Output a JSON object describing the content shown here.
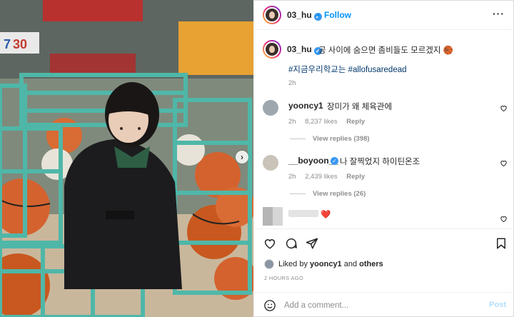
{
  "header": {
    "username": "03_hu",
    "verified_mark": "✓",
    "separator": "•",
    "follow_label": "Follow",
    "more_label": "···"
  },
  "caption": {
    "username": "03_hu",
    "text": "공 사이에 숨으면 좀비들도 모르겠지 🏀",
    "hashtags": [
      "#지금우리학교는",
      "#allofusaredead"
    ],
    "time": "2h"
  },
  "comments": [
    {
      "username": "yooncy1",
      "text": "장미가 왜 체육관에",
      "time": "2h",
      "likes": "8,237 likes",
      "reply_label": "Reply",
      "view_replies": "View replies (398)"
    },
    {
      "username": "__boyoon__",
      "text": "나 잘찍었지 하이틴온조",
      "time": "2h",
      "likes": "2,439 likes",
      "reply_label": "Reply",
      "view_replies": "View replies (26)"
    },
    {
      "username": "",
      "text": "❤️"
    }
  ],
  "actions": {
    "liked_by_prefix": "Liked by",
    "liked_by_user": "yooncy1",
    "liked_by_and": "and",
    "liked_by_others": "others",
    "post_time": "2 HOURS AGO"
  },
  "comment_box": {
    "placeholder": "Add a comment...",
    "post_label": "Post"
  },
  "photo": {
    "next_arrow": "›"
  },
  "colors": {
    "accent": "#0095f6",
    "hashtag": "#00376b",
    "muted": "#8e8e8e",
    "heart": "#ed4956",
    "crate": "#4fb7a8",
    "basketball": "#d4622e"
  },
  "icons": [
    "like-icon",
    "comment-icon",
    "share-icon",
    "save-icon",
    "emoji-icon",
    "more-icon",
    "verified-icon"
  ]
}
